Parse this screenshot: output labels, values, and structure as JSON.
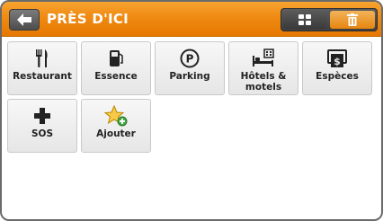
{
  "header": {
    "title": "PRÈS D'ICI",
    "accent_color": "#ef8a12",
    "back_icon": "arrow-left-icon",
    "view_icon": "grid-icon",
    "delete_icon": "trash-icon"
  },
  "categories": [
    {
      "label": "Restaurant",
      "icon": "fork-knife-icon"
    },
    {
      "label": "Essence",
      "icon": "fuel-pump-icon"
    },
    {
      "label": "Parking",
      "icon": "parking-icon"
    },
    {
      "label": "Hôtels &\nmotels",
      "icon": "bed-icon"
    },
    {
      "label": "Espèces",
      "icon": "cash-icon"
    },
    {
      "label": "SOS",
      "icon": "plus-cross-icon"
    },
    {
      "label": "Ajouter",
      "icon": "star-add-icon"
    }
  ]
}
